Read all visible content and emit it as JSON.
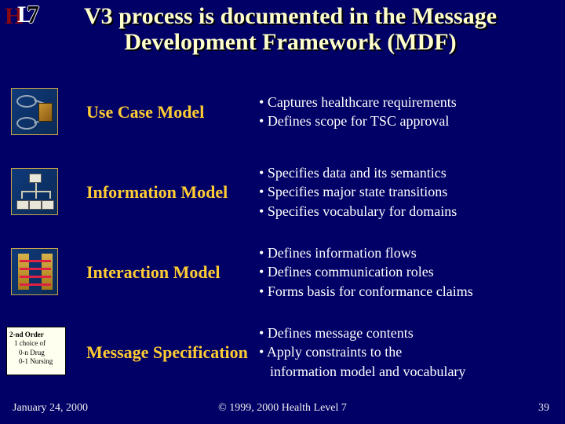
{
  "logo": {
    "part1": "H",
    "part2": "L",
    "part3": "7"
  },
  "title": "V3 process is documented in the Message Development Framework (MDF)",
  "rows": [
    {
      "label": "Use Case Model",
      "bullets": [
        "Captures healthcare requirements",
        "Defines scope for TSC approval"
      ]
    },
    {
      "label": "Information Model",
      "bullets": [
        "Specifies data and its semantics",
        "Specifies major state transitions",
        "Specifies vocabulary for domains"
      ]
    },
    {
      "label": "Interaction Model",
      "bullets": [
        "Defines information flows",
        "Defines communication roles",
        "Forms basis for conformance claims"
      ]
    },
    {
      "label": "Message Specification",
      "bullets": [
        "Defines message contents",
        "Apply constraints to the",
        "information model and vocabulary"
      ],
      "continuation_index": 2
    }
  ],
  "spec_box": {
    "lines": [
      "2-nd Order",
      "1 choice of",
      "0-n Drug",
      "0-1 Nursing"
    ]
  },
  "footer": {
    "date": "January 24, 2000",
    "copyright": "© 1999, 2000  Health Level 7",
    "page": "39"
  }
}
